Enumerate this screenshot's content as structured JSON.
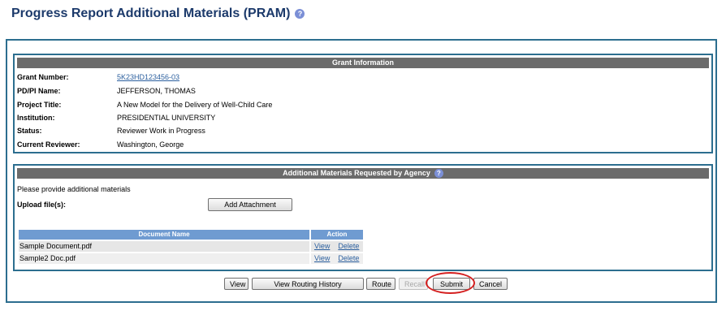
{
  "page": {
    "title": "Progress Report Additional Materials (PRAM)",
    "help_icon": "?"
  },
  "grant_info": {
    "header": "Grant Information",
    "rows": [
      {
        "label": "Grant Number:",
        "value": "5K23HD123456-03"
      },
      {
        "label": "PD/PI Name:",
        "value": "JEFFERSON, THOMAS"
      },
      {
        "label": "Project Title:",
        "value": "A New Model for the Delivery of Well-Child Care"
      },
      {
        "label": "Institution:",
        "value": "PRESIDENTIAL UNIVERSITY"
      },
      {
        "label": "Status:",
        "value": "Reviewer Work in Progress"
      },
      {
        "label": "Current Reviewer:",
        "value": "Washington, George"
      }
    ]
  },
  "additional_materials": {
    "header": "Additional Materials Requested by Agency",
    "help_icon": "?",
    "instructions": "Please provide additional materials",
    "upload_label": "Upload file(s):",
    "add_attachment_label": "Add Attachment",
    "columns": {
      "document_name": "Document Name",
      "action": "Action"
    },
    "documents": [
      {
        "name": "Sample Document.pdf",
        "view": "View",
        "delete": "Delete"
      },
      {
        "name": "Sample2 Doc.pdf",
        "view": "View",
        "delete": "Delete"
      }
    ]
  },
  "footer_buttons": {
    "view": "View",
    "routing_history": "View Routing History",
    "route": "Route",
    "recall": "Recall",
    "submit": "Submit",
    "cancel": "Cancel"
  },
  "colors": {
    "title": "#1c3a6b",
    "border": "#2c6e8f",
    "panel_header": "#6b6b6b",
    "table_header": "#6f9bd1",
    "link": "#2b5f9e",
    "highlight": "#d42020"
  }
}
